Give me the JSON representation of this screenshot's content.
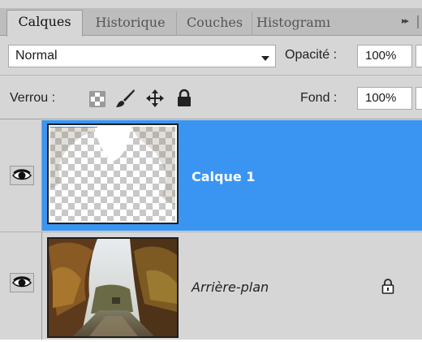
{
  "tabs": [
    {
      "label": "Calques",
      "active": true
    },
    {
      "label": "Historique",
      "active": false
    },
    {
      "label": "Couches",
      "active": false
    },
    {
      "label": "Histogramı",
      "active": false
    }
  ],
  "tab_overflow": "▸▸",
  "blend_mode": {
    "value": "Normal"
  },
  "opacity": {
    "label": "Opacité :",
    "value": "100%"
  },
  "lock": {
    "label": "Verrou :",
    "icons": [
      "lock-transparency-icon",
      "brush-icon",
      "move-icon",
      "padlock-icon"
    ]
  },
  "fill": {
    "label": "Fond :",
    "value": "100%"
  },
  "layers": [
    {
      "name": "Calque 1",
      "selected": true,
      "visible": true,
      "thumbnail": "transparent-with-photo-remnant"
    },
    {
      "name": "Arrière-plan",
      "selected": false,
      "visible": true,
      "locked": true,
      "thumbnail": "autumn-forest-path-photo"
    }
  ],
  "colors": {
    "selection": "#3a95f2",
    "panel": "#d6d6d6"
  }
}
